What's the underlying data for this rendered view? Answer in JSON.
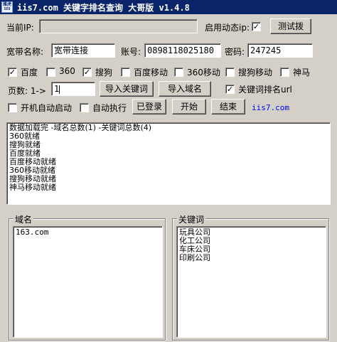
{
  "window": {
    "icon_text_top": "雅虎",
    "icon_text_bottom": "SEO",
    "title": "iis7.com 关键字排名查询 大哥版 v1.4.8"
  },
  "ip_row": {
    "current_ip_label": "当前IP:",
    "current_ip_value": "",
    "dynamic_ip_label": "启用动态ip:",
    "dynamic_ip_checked": "✓",
    "test_button": "测试拨"
  },
  "account_row": {
    "broadband_label": "宽带名称:",
    "broadband_value": "宽带连接",
    "account_label": "账号:",
    "account_value": "0898118025180",
    "password_label": "密码:",
    "password_value": "247245"
  },
  "engines": [
    {
      "label": "百度",
      "checked": "✓"
    },
    {
      "label": "360",
      "checked": ""
    },
    {
      "label": "搜狗",
      "checked": "✓"
    },
    {
      "label": "百度移动",
      "checked": ""
    },
    {
      "label": "360移动",
      "checked": ""
    },
    {
      "label": "搜狗移动",
      "checked": ""
    },
    {
      "label": "神马",
      "checked": ""
    }
  ],
  "pages_row": {
    "pages_label": "页数: 1->",
    "pages_value": "1",
    "import_keywords": "导入关键词",
    "import_domains": "导入域名",
    "keyword_url_label": "关键词排名url",
    "keyword_url_checked": "✓"
  },
  "control_row": {
    "autostart_label": "开机自动启动",
    "autostart_checked": "",
    "autorun_label": "自动执行",
    "autorun_checked": "",
    "logged_in_button": "已登录",
    "start_button": "开始",
    "end_button": "结束",
    "site_link": "iis7.com"
  },
  "log": [
    "数据加载完 -域名总数(1) -关键词总数(4)",
    "360就绪",
    "搜狗就绪",
    "百度就绪",
    "百度移动就绪",
    "360移动就绪",
    "搜狗移动就绪",
    "神马移动就绪"
  ],
  "domains": {
    "title": "域名",
    "items": [
      "163.com"
    ]
  },
  "keywords": {
    "title": "关键词",
    "items": [
      "玩具公司",
      "化工公司",
      "车床公司",
      "印刷公司"
    ]
  }
}
